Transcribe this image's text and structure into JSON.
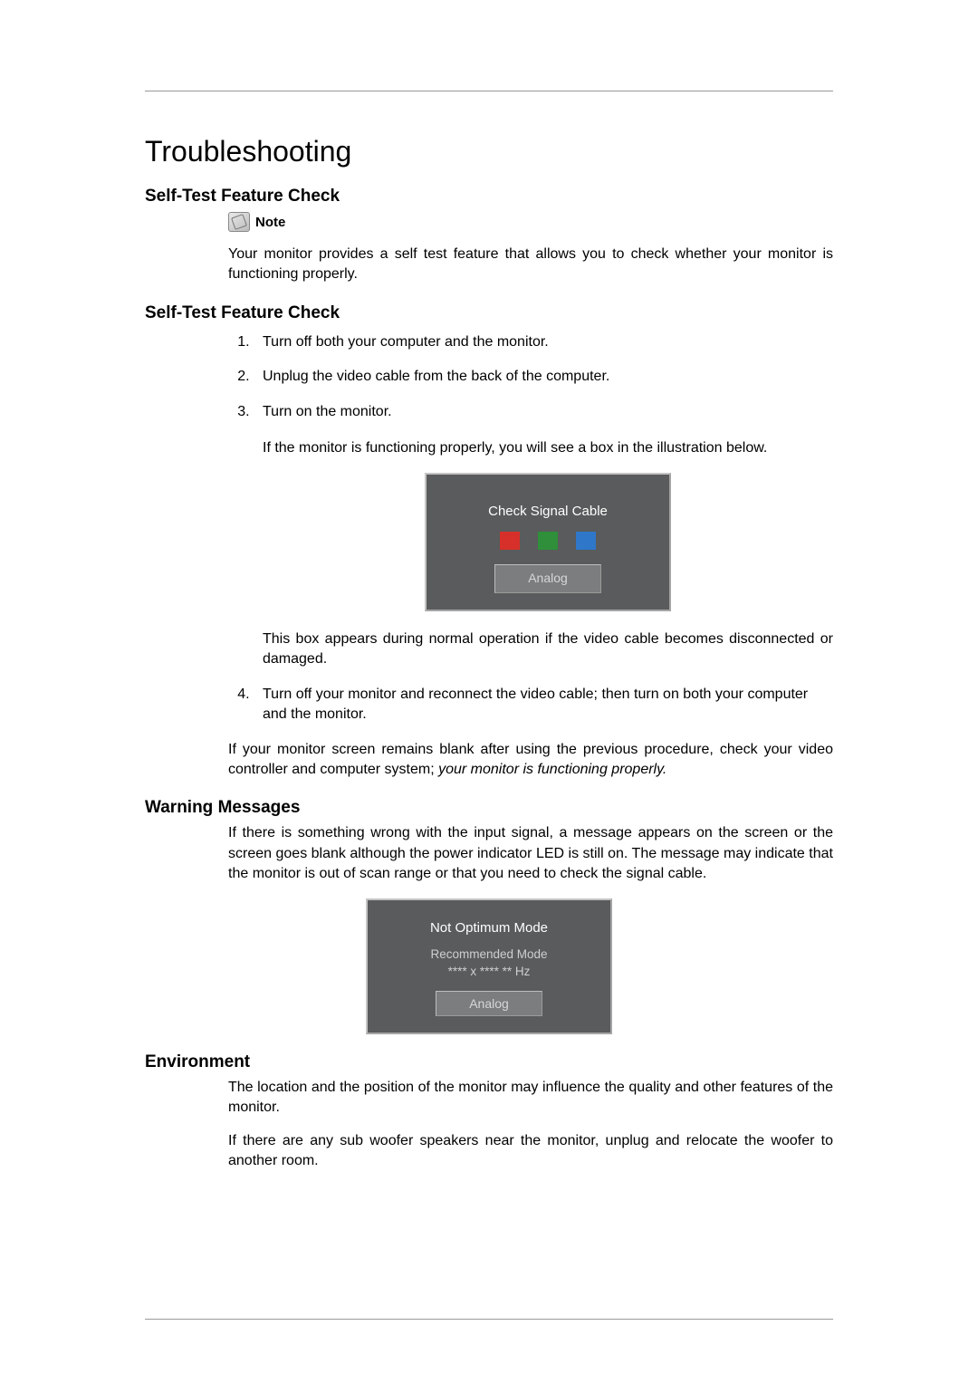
{
  "title": "Troubleshooting",
  "section1": {
    "heading": "Self-Test Feature Check",
    "note_label": "Note",
    "note_body": "Your monitor provides a self test feature that allows you to check whether your monitor is functioning properly."
  },
  "section2": {
    "heading": "Self-Test Feature Check",
    "steps": {
      "s1": "Turn off both your computer and the monitor.",
      "s2": "Unplug the video cable from the back of the computer.",
      "s3": "Turn on the monitor.",
      "s3_sub": "If the monitor is functioning properly, you will see a box in the illustration below.",
      "s3_after": "This box appears during normal operation if the video cable becomes disconnected or damaged.",
      "s4": "Turn off your monitor and reconnect the video cable; then turn on both your computer and the monitor."
    },
    "osd": {
      "heading": "Check Signal Cable",
      "button": "Analog"
    },
    "trailer_plain": "If your monitor screen remains blank after using the previous procedure, check your video controller and computer system; ",
    "trailer_italic": "your monitor is functioning properly."
  },
  "section3": {
    "heading": "Warning Messages",
    "body": "If there is something wrong with the input signal, a message appears on the screen or the screen goes blank although the power indicator LED is still on. The message may indicate that the monitor is out of scan range or that you need to check the signal cable.",
    "osd": {
      "heading": "Not  Optimum Mode",
      "sub1": "Recommended Mode",
      "sub2": "**** x ****    ** Hz",
      "button": "Analog"
    }
  },
  "section4": {
    "heading": "Environment",
    "p1": "The location and the position of the monitor may influence the quality and other features of the monitor.",
    "p2": "If there are any sub woofer speakers near the monitor, unplug and relocate the woofer to another room."
  }
}
